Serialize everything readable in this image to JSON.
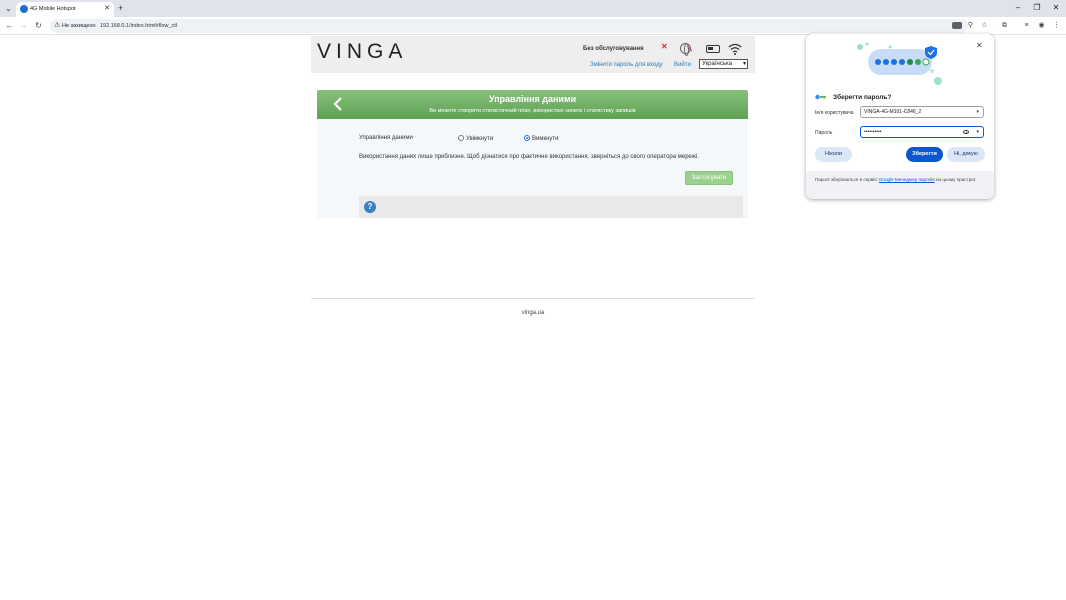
{
  "browser": {
    "tab_title": "4G Mobile Hotspot",
    "address_security": "Не захищено",
    "address_url": "192.168.0.1/index.html#flow_ctl"
  },
  "router": {
    "logo": "VINGA",
    "network_status": "Без обслуговування",
    "change_password_link": "Змінити пароль для входу",
    "logout_link": "Вийти",
    "language_selected": "Українська",
    "panel_title": "Управління даними",
    "panel_subtitle": "Ви можете створити статистичний план, використані запити і статистику запишів",
    "data_mgmt_label": "Управління даними",
    "option_enable": "Увімкнути",
    "option_disable": "Вимкнути",
    "selected_option": "disable",
    "note": "Використання даних лише приблизне. Щоб дізнатися про фактичне використання, зверніться до свого оператора мережі.",
    "apply_button": "Застосувати",
    "footer": "vinga.ua"
  },
  "password_popup": {
    "title": "Зберегти пароль?",
    "username_label": "Ім'я користувача",
    "username_value": "VINGA-4G-M101-C846_2",
    "password_label": "Пароль",
    "password_value": "••••••••••",
    "never_button": "Ніколи",
    "save_button": "Зберегти",
    "no_thanks_button": "Ні, дякую",
    "footer_prefix": "Паролі зберігаються в сервісі ",
    "footer_link": "Google Менеджер паролів",
    "footer_suffix": " на цьому пристрої."
  },
  "colors": {
    "accent_green": "#6aab5f",
    "link_blue": "#2e7db8",
    "google_blue": "#0b57d0"
  }
}
